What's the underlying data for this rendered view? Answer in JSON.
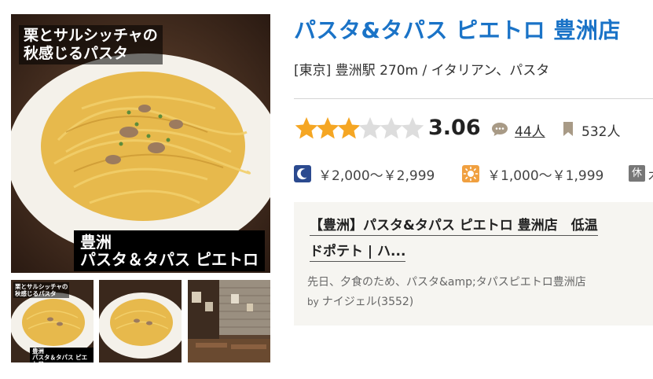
{
  "photos": {
    "main": {
      "caption_top": "栗とサルシッチャの\n秋感じるパスタ",
      "caption_bottom": "豊洲\nパスタ＆タパス ピエトロ"
    },
    "thumbs": [
      {
        "caption_top": "栗とサルシッチャの\n秋感じるパスタ",
        "caption_bottom": "豊洲\nパスタ＆タパス ピエトロ"
      },
      {
        "caption_top": "",
        "caption_bottom": ""
      },
      {
        "caption_top": "",
        "caption_bottom": ""
      }
    ]
  },
  "restaurant": {
    "name": "パスタ&タパス ピエトロ 豊洲店",
    "area_genre": "[東京] 豊洲駅 270m / イタリアン、パスタ",
    "rating": {
      "value": 3.06,
      "display": "3.06",
      "stars_filled": 3,
      "stars_total": 6,
      "star_color": "#f5a623",
      "star_empty_color": "#dddddd"
    },
    "reviews_label": "44人",
    "saves_label": "532人",
    "budget": {
      "dinner": "￥2,000～￥2,999",
      "lunch": "￥1,000～￥1,999"
    },
    "holiday_badge": "休",
    "holiday_text": "木"
  },
  "review": {
    "title_line1": "【豊洲】パスタ&タパス ピエトロ 豊洲店　低温",
    "title_line2": "ドポテト | ハ...",
    "snippet": "先日、夕食のため、パスタ&amp;タパスピエトロ豊洲店",
    "by": "by",
    "author": "ナイジェル(3552)"
  },
  "colors": {
    "title": "#1a73c7",
    "card_bg": "#f6f5f1",
    "dinner_icon": "#2b4a8f",
    "lunch_icon": "#f0a040"
  },
  "icons": {
    "rating_star": "star-icon",
    "reviews": "speech-bubble-icon",
    "saves": "bookmark-icon",
    "dinner": "moon-icon",
    "lunch": "sun-icon"
  }
}
